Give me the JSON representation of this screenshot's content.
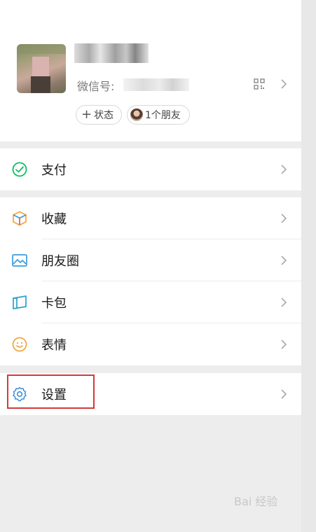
{
  "profile": {
    "wechat_id_label": "微信号:",
    "status_button": "状态",
    "friends_button": "1个朋友"
  },
  "menu": {
    "pay": "支付",
    "favorites": "收藏",
    "moments": "朋友圈",
    "cards": "卡包",
    "stickers": "表情",
    "settings": "设置"
  },
  "icons": {
    "pay": "pay-icon",
    "favorites": "favorites-cube-icon",
    "moments": "moments-picture-icon",
    "cards": "card-wallet-icon",
    "stickers": "smiley-icon",
    "settings": "gear-icon",
    "qr": "qr-code-icon",
    "chevron": "chevron-right-icon"
  },
  "watermark": "Bai 经验",
  "colors": {
    "accent_green": "#07c160",
    "highlight_red": "#d6393a",
    "background": "#ededed"
  }
}
